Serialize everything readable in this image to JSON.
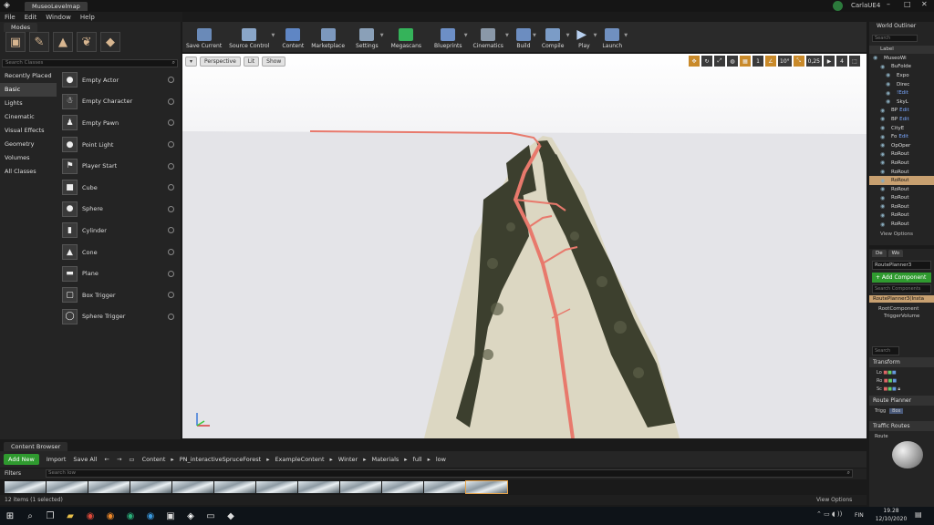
{
  "window": {
    "app_logo": "unreal-logo",
    "doc_tab": "MuseoLevelmap",
    "user": "CarlaUE4"
  },
  "menu": [
    "File",
    "Edit",
    "Window",
    "Help"
  ],
  "modes": {
    "tab": "Modes",
    "search_placeholder": "Search Classes",
    "categories": [
      "Recently Placed",
      "Basic",
      "Lights",
      "Cinematic",
      "Visual Effects",
      "Geometry",
      "Volumes",
      "All Classes"
    ],
    "selected_category": "Basic",
    "items": [
      "Empty Actor",
      "Empty Character",
      "Empty Pawn",
      "Point Light",
      "Player Start",
      "Cube",
      "Sphere",
      "Cylinder",
      "Cone",
      "Plane",
      "Box Trigger",
      "Sphere Trigger"
    ]
  },
  "toolbar": [
    "Save Current",
    "Source Control",
    "Content",
    "Marketplace",
    "Settings",
    "Megascans",
    "Blueprints",
    "Cinematics",
    "Build",
    "Compile",
    "Play",
    "Launch"
  ],
  "viewport": {
    "perspective": "Perspective",
    "lit": "Lit",
    "show": "Show",
    "grid_snap": "1",
    "rot_snap": "10°",
    "scale_snap": "0,25",
    "cam_speed": "4"
  },
  "outliner": {
    "tab": "World Outliner",
    "search_placeholder": "Search",
    "column": "Label",
    "rows": [
      {
        "label": "MuseoWi",
        "link": ""
      },
      {
        "label": "BuFolde",
        "link": ""
      },
      {
        "label": "Expo",
        "link": ""
      },
      {
        "label": "Direc",
        "link": ""
      },
      {
        "label": "!Edit",
        "link": "!Edit"
      },
      {
        "label": "SkyL",
        "link": ""
      },
      {
        "label": "BP",
        "link": "Edit"
      },
      {
        "label": "BP",
        "link": "Edit"
      },
      {
        "label": "CityE",
        "link": ""
      },
      {
        "label": "Fo",
        "link": "Edit"
      },
      {
        "label": "OpOper",
        "link": ""
      },
      {
        "label": "RoRout",
        "link": ""
      },
      {
        "label": "RoRout",
        "link": ""
      },
      {
        "label": "RoRout",
        "link": ""
      },
      {
        "label": "RoRout",
        "link": ""
      },
      {
        "label": "RoRout",
        "link": ""
      },
      {
        "label": "RoRout",
        "link": ""
      },
      {
        "label": "RoRout",
        "link": ""
      },
      {
        "label": "RoRout",
        "link": ""
      },
      {
        "label": "RoRout",
        "link": ""
      }
    ],
    "selected_index": 14,
    "view_options": "View Options"
  },
  "details": {
    "tabs": [
      "De",
      "Wo"
    ],
    "actor_name": "RoutePlanner3",
    "add_component": "+ Add Component",
    "search_components": "Search Components",
    "instance": "RoutePlanner3(Insta",
    "components": [
      "RootComponent",
      "TriggerVolume"
    ],
    "search_details": "Search",
    "transform": "Transform",
    "transform_rows": [
      "Lo",
      "Ro",
      "Sc"
    ],
    "route_planner": "Route Planner",
    "trigger_label": "Trigg",
    "trigger_value": "Box",
    "traffic_routes": "Traffic Routes",
    "route_label": "Route"
  },
  "content_browser": {
    "tab": "Content Browser",
    "add_new": "Add New",
    "import": "Import",
    "save_all": "Save All",
    "path": [
      "Content",
      "PN_interactiveSpruceForest",
      "ExampleContent",
      "Winter",
      "Materials",
      "full",
      "low"
    ],
    "filters": "Filters",
    "search_placeholder": "Search low",
    "status": "12 items (1 selected)",
    "view_options": "View Options"
  },
  "taskbar": {
    "time": "19.28",
    "date": "12/10/2020",
    "lang": "FIN"
  },
  "colors": {
    "route_red": "#e8796c",
    "unreal_green": "#2f9a2f",
    "selection": "#c8a070"
  }
}
